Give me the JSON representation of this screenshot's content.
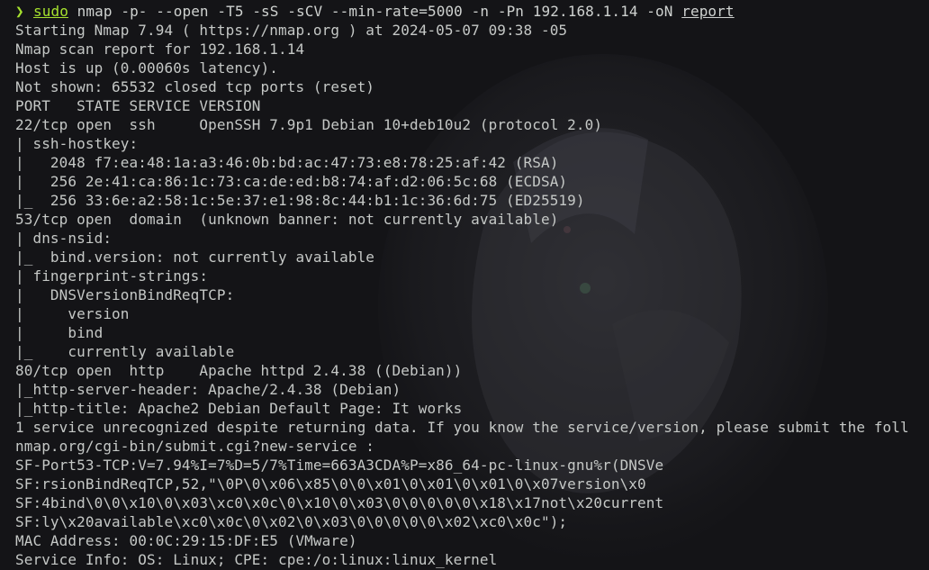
{
  "prompt": {
    "symbol": "❯",
    "command": "sudo",
    "args": " nmap -p- --open -T5 -sS -sCV --min-rate=5000 -n -Pn 192.168.1.14 -oN ",
    "output_file": "report"
  },
  "output_lines": [
    "Starting Nmap 7.94 ( https://nmap.org ) at 2024-05-07 09:38 -05",
    "Nmap scan report for 192.168.1.14",
    "Host is up (0.00060s latency).",
    "Not shown: 65532 closed tcp ports (reset)",
    "PORT   STATE SERVICE VERSION",
    "22/tcp open  ssh     OpenSSH 7.9p1 Debian 10+deb10u2 (protocol 2.0)",
    "| ssh-hostkey: ",
    "|   2048 f7:ea:48:1a:a3:46:0b:bd:ac:47:73:e8:78:25:af:42 (RSA)",
    "|   256 2e:41:ca:86:1c:73:ca:de:ed:b8:74:af:d2:06:5c:68 (ECDSA)",
    "|_  256 33:6e:a2:58:1c:5e:37:e1:98:8c:44:b1:1c:36:6d:75 (ED25519)",
    "53/tcp open  domain  (unknown banner: not currently available)",
    "| dns-nsid: ",
    "|_  bind.version: not currently available",
    "| fingerprint-strings: ",
    "|   DNSVersionBindReqTCP: ",
    "|     version",
    "|     bind",
    "|_    currently available",
    "80/tcp open  http    Apache httpd 2.4.38 ((Debian))",
    "|_http-server-header: Apache/2.4.38 (Debian)",
    "|_http-title: Apache2 Debian Default Page: It works",
    "1 service unrecognized despite returning data. If you know the service/version, please submit the foll",
    "nmap.org/cgi-bin/submit.cgi?new-service :",
    "SF-Port53-TCP:V=7.94%I=7%D=5/7%Time=663A3CDA%P=x86_64-pc-linux-gnu%r(DNSVe",
    "SF:rsionBindReqTCP,52,\"\\0P\\0\\x06\\x85\\0\\0\\x01\\0\\x01\\0\\x01\\0\\x07version\\x0",
    "SF:4bind\\0\\0\\x10\\0\\x03\\xc0\\x0c\\0\\x10\\0\\x03\\0\\0\\0\\0\\0\\x18\\x17not\\x20current",
    "SF:ly\\x20available\\xc0\\x0c\\0\\x02\\0\\x03\\0\\0\\0\\0\\0\\x02\\xc0\\x0c\");",
    "MAC Address: 00:0C:29:15:DF:E5 (VMware)",
    "Service Info: OS: Linux; CPE: cpe:/o:linux:linux_kernel"
  ],
  "colors": {
    "background": "#141417",
    "foreground": "#c5c8c6",
    "prompt_accent": "#a6e22e"
  }
}
